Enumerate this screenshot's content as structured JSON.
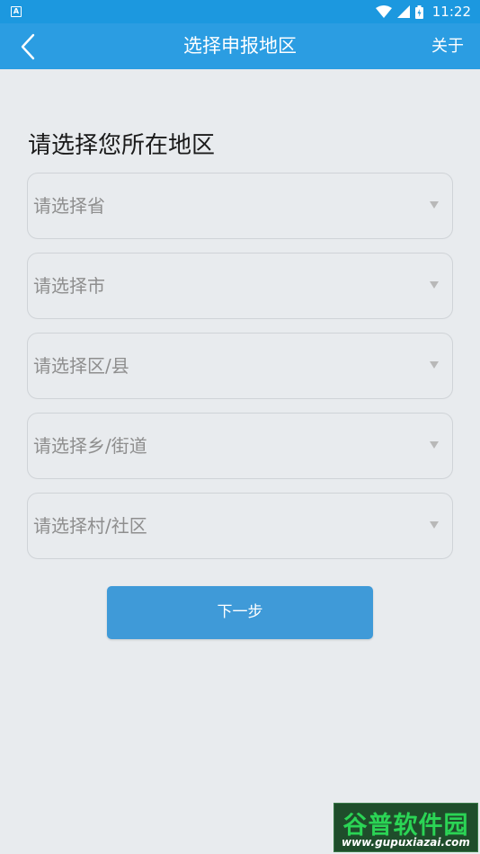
{
  "status_bar": {
    "time": "11:22",
    "notification_icon": "A",
    "icons": [
      "wifi-icon",
      "signal-icon",
      "battery-icon"
    ]
  },
  "app_bar": {
    "title": "选择申报地区",
    "about_label": "关于",
    "back_icon": "back-arrow-icon"
  },
  "form": {
    "heading": "请选择您所在地区",
    "selects": [
      {
        "placeholder": "请选择省"
      },
      {
        "placeholder": "请选择市"
      },
      {
        "placeholder": "请选择区/县"
      },
      {
        "placeholder": "请选择乡/街道"
      },
      {
        "placeholder": "请选择村/社区"
      }
    ],
    "next_label": "下一步"
  },
  "watermark": {
    "title": "谷普软件园",
    "url": "www.gupuxiazai.com"
  },
  "colors": {
    "app_bar": "#2b9de2",
    "status_bar": "#1c98df",
    "background": "#e8ebee",
    "button": "#3f9ad8"
  }
}
